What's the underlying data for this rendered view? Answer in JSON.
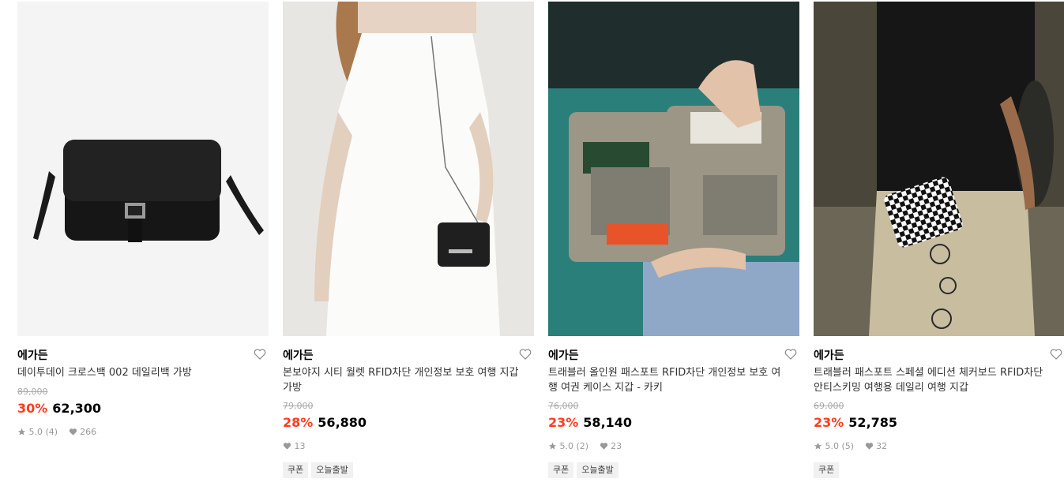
{
  "products": [
    {
      "brand": "에가든",
      "title": "데이투데이 크로스백 002 데일리백 가방",
      "original_price": "89,000",
      "discount_rate": "30%",
      "price": "62,300",
      "rating": "5.0 (4)",
      "likes": "266",
      "tags": []
    },
    {
      "brand": "에가든",
      "title": "본보야지 시티 월렛 RFID차단 개인정보 보호 여행 지갑 가방",
      "original_price": "79,000",
      "discount_rate": "28%",
      "price": "56,880",
      "rating": "",
      "likes": "13",
      "tags": [
        "쿠폰",
        "오늘출발"
      ]
    },
    {
      "brand": "에가든",
      "title": "트래블러 올인원 패스포트 RFID차단 개인정보 보호 여행 여권 케이스 지갑 - 카키",
      "original_price": "76,000",
      "discount_rate": "23%",
      "price": "58,140",
      "rating": "5.0 (2)",
      "likes": "23",
      "tags": [
        "쿠폰",
        "오늘출발"
      ]
    },
    {
      "brand": "에가든",
      "title": "트래블러 패스포트 스페셜 에디션 체커보드 RFID차단 안티스키밍 여행용 데일리 여행 지갑",
      "original_price": "69,000",
      "discount_rate": "23%",
      "price": "52,785",
      "rating": "5.0 (5)",
      "likes": "32",
      "tags": [
        "쿠폰"
      ]
    }
  ],
  "images": [
    {
      "subject": "black-crossbody-bag",
      "bg": "#f3f3f3"
    },
    {
      "subject": "woman-white-dress-mini-wallet",
      "bg": "#e9e7e3"
    },
    {
      "subject": "passport-wallet-khaki",
      "bg": "#2f8a86"
    },
    {
      "subject": "checkerboard-wallet-skater",
      "bg": "#3b3a33"
    }
  ],
  "colors": {
    "discount": "#ff3b1f",
    "muted": "#999999",
    "tag_bg": "#f1f1f1"
  }
}
